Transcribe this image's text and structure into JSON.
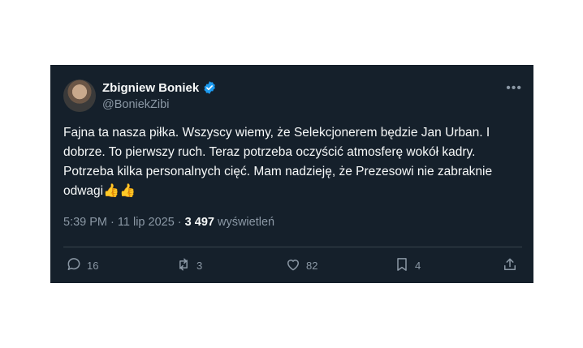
{
  "author": {
    "name": "Zbigniew Boniek",
    "handle": "@BoniekZibi"
  },
  "tweet": {
    "text": "Fajna ta nasza piłka. Wszyscy wiemy, że Selekcjonerem będzie Jan Urban. I dobrze. To pierwszy ruch. Teraz potrzeba oczyścić atmosferę wokół kadry. Potrzeba kilka personalnych cięć. Mam nadzieję, że Prezesowi nie zabraknie odwagi",
    "emoji": "👍👍"
  },
  "meta": {
    "time": "5:39 PM",
    "separator": " · ",
    "date": "11 lip 2025",
    "views_count": "3 497",
    "views_label": "wyświetleń"
  },
  "actions": {
    "replies": "16",
    "reposts": "3",
    "likes": "82",
    "bookmarks": "4"
  },
  "icons": [
    "verified-badge-icon",
    "more-icon",
    "reply-icon",
    "repost-icon",
    "like-icon",
    "bookmark-icon",
    "share-icon"
  ],
  "colors": {
    "background": "#15202b",
    "text": "#f7f9f9",
    "muted": "#8b98a5",
    "verified": "#1d9bf0"
  }
}
